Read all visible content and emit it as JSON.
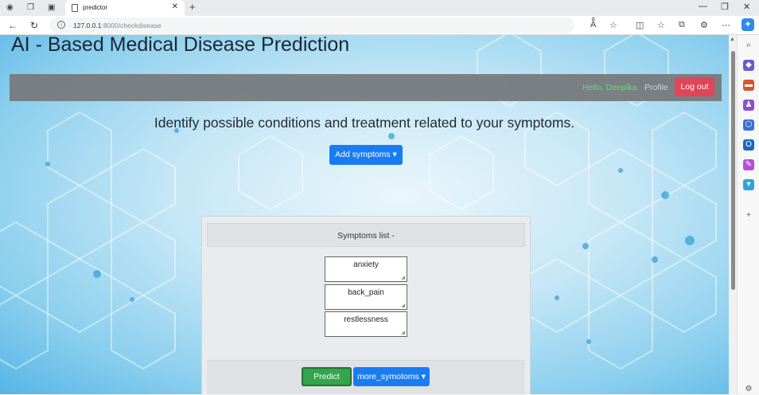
{
  "browser": {
    "tab_title": "predictor",
    "tab_close": "✕",
    "new_tab": "+",
    "url_host": "127.0.0.1",
    "url_rest": ":8000/checkdisease",
    "info_glyph": "i",
    "win_min": "—",
    "win_max": "❐",
    "win_close": "✕"
  },
  "page": {
    "site_title": "AI - Based Medical Disease Prediction",
    "navbar": {
      "greeting": "Hello, Deepika",
      "profile_label": "Profile",
      "logout_label": "Log out"
    },
    "headline": "Identify possible conditions and treatment related to your symptoms.",
    "add_symptoms_label": "Add symptoms ▾",
    "panel": {
      "header": "Symptoms list -",
      "symptoms": [
        "anxiety",
        "back_pain",
        "restlessness"
      ],
      "predict_label": "Predict",
      "more_label": "more_symotoms ▾"
    }
  },
  "colors": {
    "logout": "#e34052",
    "primary": "#1a7cf2",
    "success": "#31a64a",
    "greeting": "#5ce06a"
  },
  "icons": [
    "back-icon",
    "refresh-icon",
    "info-icon",
    "read-aloud-icon",
    "favorite-icon",
    "split-screen-icon",
    "favorites-bar-icon",
    "collections-icon",
    "extensions-icon",
    "more-icon",
    "copilot-icon"
  ]
}
